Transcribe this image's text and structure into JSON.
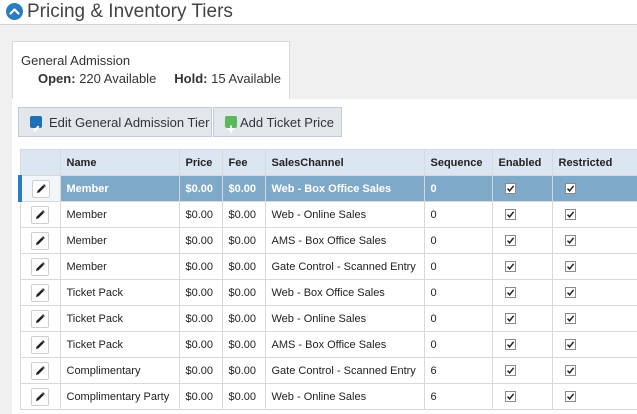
{
  "page": {
    "title": "Pricing & Inventory Tiers"
  },
  "tier": {
    "name": "General Admission",
    "open_label": "Open:",
    "open_value": "220 Available",
    "hold_label": "Hold:",
    "hold_value": "15 Available"
  },
  "toolbar": {
    "edit_label": "Edit General Admission Tier",
    "add_label": "Add Ticket Price"
  },
  "table": {
    "headers": [
      "",
      "Name",
      "Price",
      "Fee",
      "SalesChannel",
      "Sequence",
      "Enabled",
      "Restricted"
    ],
    "rows": [
      {
        "name": "Member",
        "price": "$0.00",
        "fee": "$0.00",
        "channel": "Web - Box Office Sales",
        "sequence": "0",
        "enabled": true,
        "restricted": true,
        "selected": true
      },
      {
        "name": "Member",
        "price": "$0.00",
        "fee": "$0.00",
        "channel": "Web - Online Sales",
        "sequence": "0",
        "enabled": true,
        "restricted": true,
        "selected": false
      },
      {
        "name": "Member",
        "price": "$0.00",
        "fee": "$0.00",
        "channel": "AMS - Box Office Sales",
        "sequence": "0",
        "enabled": true,
        "restricted": true,
        "selected": false
      },
      {
        "name": "Member",
        "price": "$0.00",
        "fee": "$0.00",
        "channel": "Gate Control - Scanned Entry",
        "sequence": "0",
        "enabled": true,
        "restricted": true,
        "selected": false
      },
      {
        "name": "Ticket Pack",
        "price": "$0.00",
        "fee": "$0.00",
        "channel": "Web - Box Office Sales",
        "sequence": "0",
        "enabled": true,
        "restricted": true,
        "selected": false
      },
      {
        "name": "Ticket Pack",
        "price": "$0.00",
        "fee": "$0.00",
        "channel": "Web - Online Sales",
        "sequence": "0",
        "enabled": true,
        "restricted": true,
        "selected": false
      },
      {
        "name": "Ticket Pack",
        "price": "$0.00",
        "fee": "$0.00",
        "channel": "AMS - Box Office Sales",
        "sequence": "0",
        "enabled": true,
        "restricted": true,
        "selected": false
      },
      {
        "name": "Complimentary",
        "price": "$0.00",
        "fee": "$0.00",
        "channel": "Gate Control - Scanned Entry",
        "sequence": "6",
        "enabled": true,
        "restricted": true,
        "selected": false
      },
      {
        "name": "Complimentary Party",
        "price": "$0.00",
        "fee": "$0.00",
        "channel": "Web - Online Sales",
        "sequence": "6",
        "enabled": true,
        "restricted": true,
        "selected": false
      }
    ]
  },
  "colors": {
    "accent": "#2a7cc3",
    "header_bg": "#dce6f2",
    "selected_row": "#7fa9c8",
    "add_icon": "#5cb85c"
  },
  "icons": {
    "collapse": "chevron-up-icon",
    "edit_tier": "edit-icon",
    "add_price": "plus-icon",
    "row_edit": "pencil-icon",
    "checkbox": "checkmark-icon"
  }
}
